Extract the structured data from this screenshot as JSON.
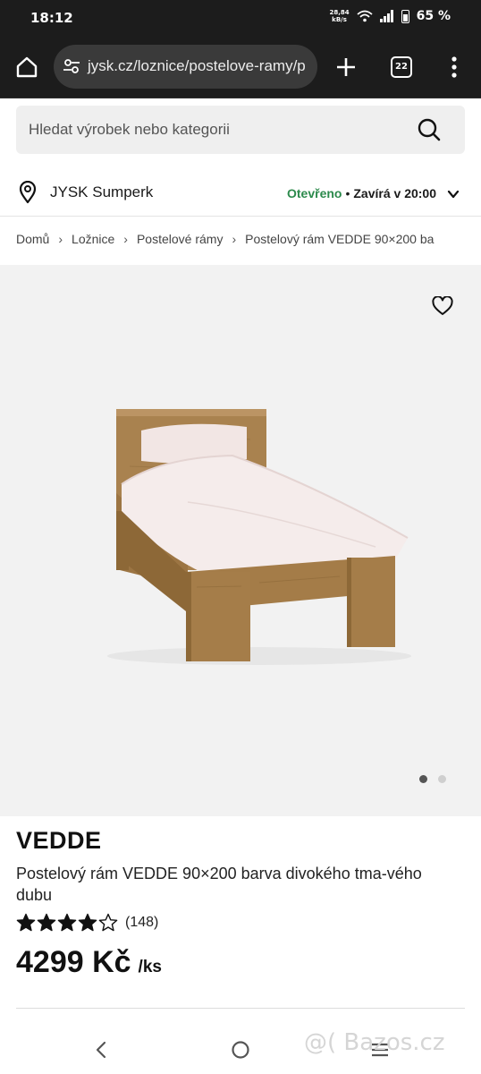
{
  "status_bar": {
    "time": "18:12",
    "net_speed_value": "28,84",
    "net_speed_unit": "kB/s",
    "battery": "65 %"
  },
  "browser": {
    "url": "jysk.cz/loznice/postelove-ramy/p",
    "tab_count": "22"
  },
  "search": {
    "placeholder": "Hledat výrobek nebo kategorii"
  },
  "store": {
    "name": "JYSK Sumperk",
    "status_open": "Otevřeno",
    "separator": "•",
    "closes": "Zavírá v 20:00"
  },
  "breadcrumb": {
    "items": [
      "Domů",
      "Ložnice",
      "Postelové rámy",
      "Postelový rám VEDDE 90×200 ba"
    ],
    "separator": "›"
  },
  "gallery": {
    "image_alt": "Postelový rám VEDDE",
    "slide_count": 2,
    "active_slide": 1
  },
  "product": {
    "brand": "VEDDE",
    "name": "Postelový rám VEDDE 90×200 barva divokého tma-vého dubu",
    "rating_value": 4,
    "rating_max": 5,
    "rating_count": "(148)",
    "price": "4299 Kč",
    "price_unit": "/ks"
  },
  "watermark": "@( Bazos.cz",
  "colors": {
    "accent_green": "#2c8a4c",
    "chrome_dark": "#1c1c1c",
    "image_bg": "#f2f2f2"
  }
}
